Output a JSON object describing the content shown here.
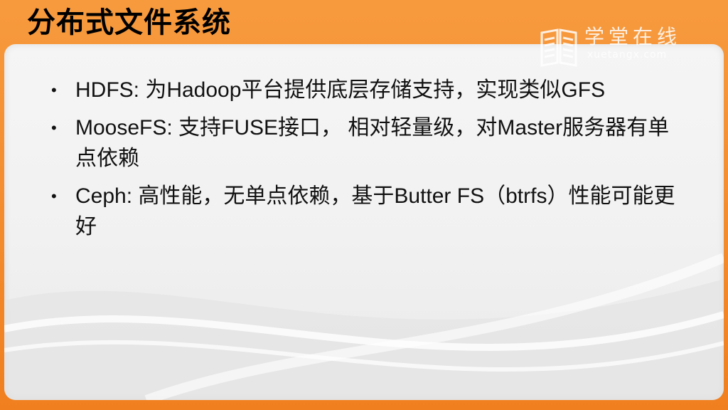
{
  "slide": {
    "title": "分布式文件系统",
    "bullets": [
      "HDFS: 为Hadoop平台提供底层存储支持，实现类似GFS",
      "MooseFS: 支持FUSE接口， 相对轻量级，对Master服务器有单点依赖",
      "Ceph: 高性能，无单点依赖，基于Butter FS（btrfs）性能可能更好"
    ],
    "bullet_symbol": "•"
  },
  "logo": {
    "name_cn": "学堂在线",
    "name_en": "xuetangx.com",
    "icon": "open-book-icon"
  },
  "colors": {
    "frame_orange": "#f58a2a",
    "panel": "#f2f2f2",
    "text": "#111111"
  }
}
